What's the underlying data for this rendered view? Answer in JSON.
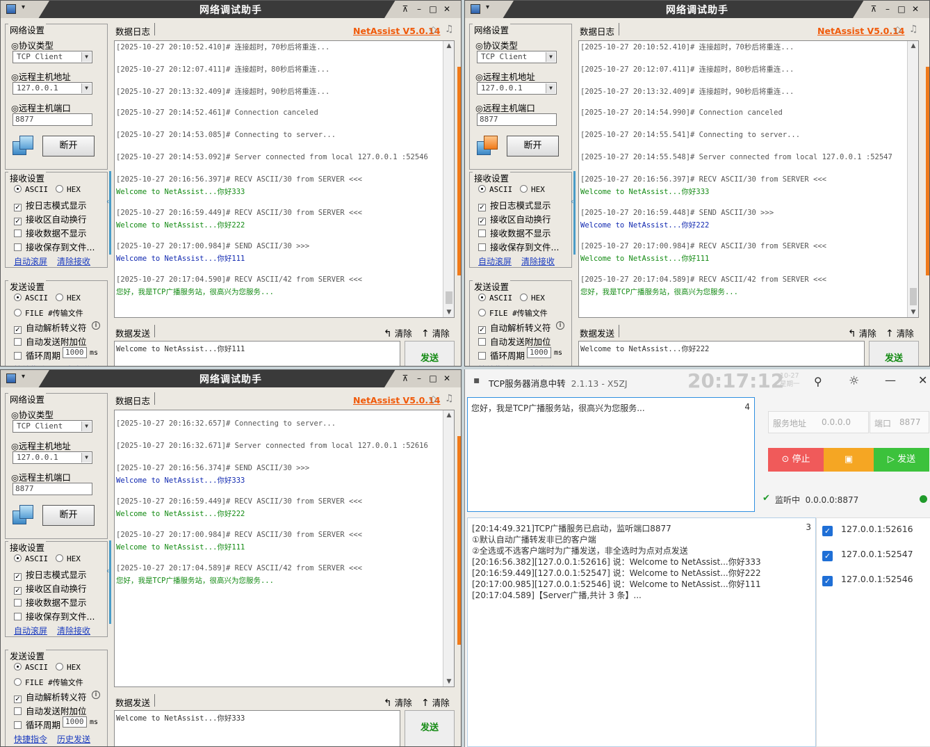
{
  "common": {
    "title": "网络调试助手",
    "brand": "NetAssist V5.0.14",
    "net_settings": "网络设置",
    "protocol_label": "◎协议类型",
    "protocol_value": "TCP Client",
    "host_label": "◎远程主机地址",
    "host_value": "127.0.0.1",
    "port_label": "◎远程主机端口",
    "port_value": "8877",
    "disconnect": "断开",
    "recv_settings": "接收设置",
    "ascii": "ASCII",
    "hex": "HEX",
    "recv_log_mode": "按日志模式显示",
    "recv_autowrap": "接收区自动换行",
    "recv_hide": "接收数据不显示",
    "recv_save": "接收保存到文件...",
    "auto_clear": "自动滚屏",
    "clear_recv": "清除接收",
    "send_settings": "发送设置",
    "file_mode": "FILE #传输文件",
    "auto_escape": "自动解析转义符",
    "append_check": "自动发送附加位",
    "cycle": "循环周期",
    "cycle_value": "1000",
    "ms": "ms",
    "quick_cmd": "快捷指令",
    "history": "历史发送",
    "tab_log": "数据日志",
    "tab_send": "数据发送",
    "clear1": "清除",
    "clear2": "清除",
    "send": "发送"
  },
  "win1": {
    "lines": [
      {
        "t": "[2025-10-27 20:10:52.410]# 连接超时，70秒后将重连...",
        "c": ""
      },
      {
        "t": "[2025-10-27 20:12:07.411]# 连接超时，80秒后将重连...",
        "c": ""
      },
      {
        "t": "[2025-10-27 20:13:32.409]# 连接超时，90秒后将重连...",
        "c": ""
      },
      {
        "t": "[2025-10-27 20:14:52.461]# Connection canceled",
        "c": ""
      },
      {
        "t": "[2025-10-27 20:14:53.085]# Connecting to server...",
        "c": ""
      },
      {
        "t": "[2025-10-27 20:14:53.092]# Server connected from local 127.0.0.1 :52546",
        "c": ""
      },
      {
        "t": "[2025-10-27 20:16:56.397]# RECV ASCII/30 from SERVER <<<",
        "c": ""
      },
      {
        "t": "Welcome to NetAssist...你好333",
        "c": "g"
      },
      {
        "t": "[2025-10-27 20:16:59.449]# RECV ASCII/30 from SERVER <<<",
        "c": ""
      },
      {
        "t": "Welcome to NetAssist...你好222",
        "c": "g"
      },
      {
        "t": "[2025-10-27 20:17:00.984]# SEND ASCII/30 >>>",
        "c": ""
      },
      {
        "t": "Welcome to NetAssist...你好111",
        "c": "b"
      },
      {
        "t": "[2025-10-27 20:17:04.590]# RECV ASCII/42 from SERVER <<<",
        "c": ""
      },
      {
        "t": "您好，我是TCP广播服务站，很高兴为您服务...",
        "c": "g"
      }
    ],
    "send_text": "Welcome to NetAssist...你好111"
  },
  "win2": {
    "lines": [
      {
        "t": "[2025-10-27 20:10:52.410]# 连接超时，70秒后将重连...",
        "c": ""
      },
      {
        "t": "[2025-10-27 20:12:07.411]# 连接超时，80秒后将重连...",
        "c": ""
      },
      {
        "t": "[2025-10-27 20:13:32.409]# 连接超时，90秒后将重连...",
        "c": ""
      },
      {
        "t": "[2025-10-27 20:14:54.990]# Connection canceled",
        "c": ""
      },
      {
        "t": "[2025-10-27 20:14:55.541]# Connecting to server...",
        "c": ""
      },
      {
        "t": "[2025-10-27 20:14:55.548]# Server connected from local 127.0.0.1 :52547",
        "c": ""
      },
      {
        "t": "[2025-10-27 20:16:56.397]# RECV ASCII/30 from SERVER <<<",
        "c": ""
      },
      {
        "t": "Welcome to NetAssist...你好333",
        "c": "g"
      },
      {
        "t": "[2025-10-27 20:16:59.448]# SEND ASCII/30 >>>",
        "c": ""
      },
      {
        "t": "Welcome to NetAssist...你好222",
        "c": "b"
      },
      {
        "t": "[2025-10-27 20:17:00.984]# RECV ASCII/30 from SERVER <<<",
        "c": ""
      },
      {
        "t": "Welcome to NetAssist...你好111",
        "c": "g"
      },
      {
        "t": "[2025-10-27 20:17:04.589]# RECV ASCII/42 from SERVER <<<",
        "c": ""
      },
      {
        "t": "您好，我是TCP广播服务站，很高兴为您服务...",
        "c": "g"
      }
    ],
    "send_text": "Welcome to NetAssist...你好222"
  },
  "win3": {
    "lines": [
      {
        "t": "[2025-10-27 20:16:32.657]# Connecting to server...",
        "c": ""
      },
      {
        "t": "[2025-10-27 20:16:32.671]# Server connected from local 127.0.0.1 :52616",
        "c": ""
      },
      {
        "t": "[2025-10-27 20:16:56.374]# SEND ASCII/30 >>>",
        "c": ""
      },
      {
        "t": "Welcome to NetAssist...你好333",
        "c": "b"
      },
      {
        "t": "[2025-10-27 20:16:59.449]# RECV ASCII/30 from SERVER <<<",
        "c": ""
      },
      {
        "t": "Welcome to NetAssist...你好222",
        "c": "g"
      },
      {
        "t": "[2025-10-27 20:17:00.984]# RECV ASCII/30 from SERVER <<<",
        "c": ""
      },
      {
        "t": "Welcome to NetAssist...你好111",
        "c": "g"
      },
      {
        "t": "[2025-10-27 20:17:04.589]# RECV ASCII/42 from SERVER <<<",
        "c": ""
      },
      {
        "t": "您好，我是TCP广播服务站，很高兴为您服务...",
        "c": "g"
      }
    ],
    "send_text": "Welcome to NetAssist...你好333"
  },
  "tk": {
    "title": "TCP服务器消息中转",
    "version": "2.1.13 - X5ZJ",
    "clock": "20:17:12",
    "date_line1": "10-27",
    "date_line2": "星期一",
    "message": "您好，我是TCP广播服务站，很高兴为您服务...",
    "message_count": "4",
    "addr_label": "服务地址",
    "addr_value": "0.0.0.0",
    "port_label": "端口",
    "port_value": "8877",
    "stop": "停止",
    "send": "发送",
    "status": "监听中",
    "status_addr": "0.0.0.0:8877",
    "log_count": "3",
    "log": [
      "[20:14:49.321]TCP广播服务已启动，监听端口8877",
      "①默认自动广播转发非已的客户端",
      "②全选或不选客户端时为广播发送，非全选时为点对点发送",
      "[20:16:56.382][127.0.0.1:52616] 说：Welcome to NetAssist...你好333",
      "[20:16:59.449][127.0.0.1:52547] 说：Welcome to NetAssist...你好222",
      "[20:17:00.985][127.0.0.1:52546] 说：Welcome to NetAssist...你好111",
      "[20:17:04.589]【Server广播,共计 3 条】..."
    ],
    "clients": [
      "127.0.0.1:52616",
      "127.0.0.1:52547",
      "127.0.0.1:52546"
    ],
    "colors": {
      "stop": "#f05a5a",
      "save": "#f5a623",
      "send": "#3cc23c",
      "status": "#1f9a2a"
    }
  }
}
